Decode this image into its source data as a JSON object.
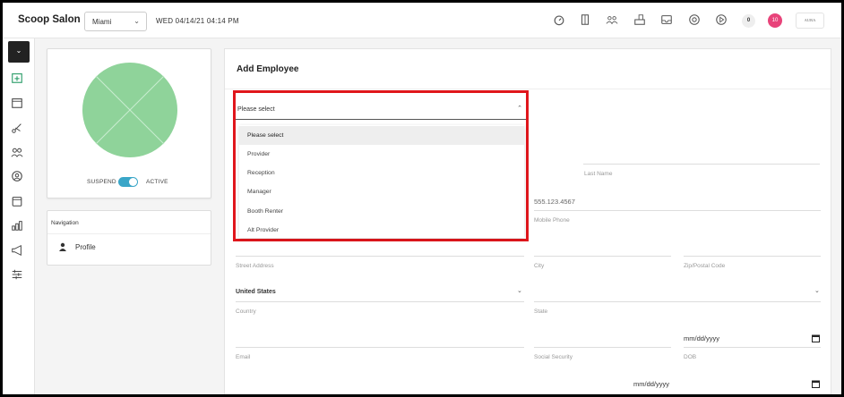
{
  "app": {
    "brand": "Scoop Salon"
  },
  "header": {
    "location": "Miami",
    "datetime": "WED 04/14/21  04:14 PM",
    "notif_count": "0",
    "alert_count": "10",
    "user_chip": "AURA",
    "icons": [
      "dashboard-icon",
      "door-icon",
      "group-icon",
      "register-icon",
      "inbox-icon",
      "support-icon",
      "play-icon"
    ]
  },
  "rail": {
    "icons": [
      "calendar-add-icon",
      "calendar-icon",
      "scissors-icon",
      "people-icon",
      "at-icon",
      "box-icon",
      "chart-icon",
      "megaphone-icon",
      "sliders-icon"
    ]
  },
  "profile": {
    "suspend_label": "SUSPEND",
    "active_label": "ACTIVE",
    "toggle_on": true,
    "avatar_color": "#8fd39a"
  },
  "navigation": {
    "title": "Navigation",
    "items": [
      {
        "label": "Profile"
      }
    ]
  },
  "form": {
    "title": "Add Employee",
    "role_select": {
      "value": "Please select",
      "options": [
        "Please select",
        "Provider",
        "Reception",
        "Manager",
        "Booth Renter",
        "Alt Provider"
      ],
      "highlight_color": "#e0161c"
    },
    "last_name_label": "Last Name",
    "phone_placeholder": "555.123.4567",
    "mobile_label": "Mobile Phone",
    "street_label": "Street Address",
    "city_label": "City",
    "zip_label": "Zip/Postal Code",
    "country_value": "United States",
    "country_label": "Country",
    "state_label": "State",
    "email_label": "Email",
    "ssn_label": "Social Security",
    "dob_label": "DOB",
    "dob_placeholder": "mm/dd/yyyy",
    "date2_placeholder": "mm/dd/yyyy"
  }
}
